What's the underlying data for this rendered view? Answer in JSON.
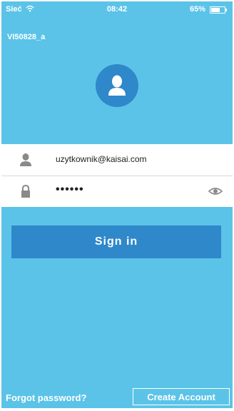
{
  "status_bar": {
    "carrier": "Sieć",
    "time": "08:42",
    "battery": "65%",
    "wifi_icon": "wifi-icon",
    "battery_icon": "battery-icon"
  },
  "device": {
    "name": "VI50828_a"
  },
  "avatar": {
    "icon": "user-avatar-icon",
    "color": "#2f88c9"
  },
  "login_form": {
    "username_icon": "person-icon",
    "username_value": "uzytkownik@kaisai.com",
    "password_icon": "lock-icon",
    "password_value": "••••••",
    "visibility_icon": "eye-icon"
  },
  "actions": {
    "sign_in_label": "Sign in",
    "forgot_label": "Forgot password?",
    "create_label": "Create Account"
  },
  "colors": {
    "background": "#5bc3e8",
    "primary": "#2f88c9",
    "card": "#ffffff"
  }
}
